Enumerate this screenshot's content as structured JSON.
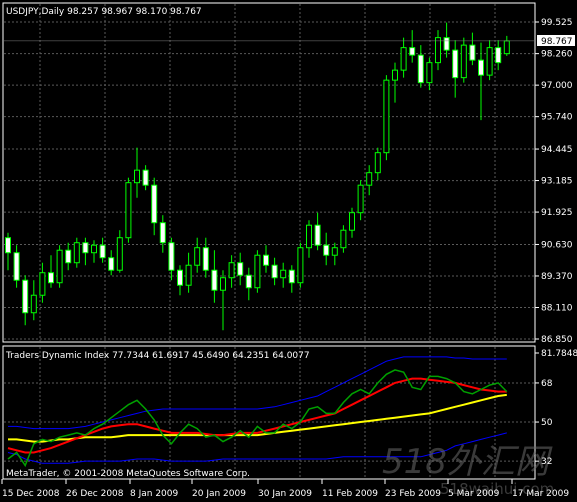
{
  "price_panel": {
    "title": "USDJPY,Daily  98.257 98.967 98.170 98.767",
    "current_price_tag": "98.767",
    "y_labels": [
      "99.525",
      "98.260",
      "97.000",
      "95.740",
      "94.445",
      "93.185",
      "91.925",
      "90.630",
      "89.370",
      "88.110",
      "86.850"
    ]
  },
  "indicator_panel": {
    "title": "Traders Dynamic Index 77.7344 61.6917 45.6490 64.2351 64.0077",
    "y_labels": [
      "81.7848",
      "68",
      "50",
      "32"
    ]
  },
  "copyright": "MetaTrader, © 2001-2008 MetaQuotes Software Corp.",
  "x_labels": [
    "15 Dec 2008",
    "26 Dec 2008",
    "8 Jan 2009",
    "20 Jan 2009",
    "30 Jan 2009",
    "11 Feb 2009",
    "23 Feb 2009",
    "5 Mar 2009",
    "17 Mar 2009"
  ],
  "watermark": {
    "main": "518外汇网",
    "sub": "518waihui.com"
  },
  "colors": {
    "background": "#000000",
    "grid": "#5a5a5a",
    "candle": "#00ff00",
    "bull_fill": "#000000",
    "bear_fill": "#ffffff",
    "tdi_green": "#00a000",
    "tdi_red": "#ff0000",
    "tdi_yellow": "#ffff00",
    "tdi_blue": "#0000ff"
  },
  "chart_data": [
    {
      "type": "candlestick",
      "title": "USDJPY,Daily",
      "ylim": [
        86.85,
        99.525
      ],
      "candles": [
        [
          90.9,
          91.1,
          89.6,
          90.3
        ],
        [
          90.3,
          90.6,
          88.9,
          89.2
        ],
        [
          89.2,
          89.4,
          87.4,
          87.9
        ],
        [
          87.9,
          89.2,
          87.6,
          88.6
        ],
        [
          88.6,
          89.9,
          88.3,
          89.5
        ],
        [
          89.5,
          90.2,
          88.9,
          89.1
        ],
        [
          89.1,
          90.6,
          88.9,
          90.4
        ],
        [
          90.4,
          90.7,
          89.6,
          89.9
        ],
        [
          89.9,
          90.9,
          89.7,
          90.7
        ],
        [
          90.7,
          90.9,
          89.8,
          90.3
        ],
        [
          90.3,
          90.8,
          89.9,
          90.6
        ],
        [
          90.6,
          90.9,
          89.9,
          90.1
        ],
        [
          90.1,
          90.4,
          89.4,
          89.6
        ],
        [
          89.6,
          91.2,
          89.5,
          90.9
        ],
        [
          90.9,
          93.3,
          90.7,
          93.1
        ],
        [
          93.1,
          94.5,
          92.5,
          93.6
        ],
        [
          93.6,
          93.8,
          92.8,
          93.0
        ],
        [
          93.0,
          93.3,
          91.0,
          91.5
        ],
        [
          91.5,
          91.8,
          90.3,
          90.7
        ],
        [
          90.7,
          90.9,
          89.2,
          89.6
        ],
        [
          89.6,
          89.8,
          88.6,
          89.0
        ],
        [
          89.0,
          90.3,
          88.7,
          89.8
        ],
        [
          89.8,
          90.9,
          89.5,
          90.5
        ],
        [
          90.5,
          90.9,
          89.3,
          89.6
        ],
        [
          89.6,
          90.4,
          88.3,
          88.8
        ],
        [
          88.8,
          89.6,
          87.2,
          89.3
        ],
        [
          89.3,
          90.2,
          88.9,
          89.9
        ],
        [
          89.9,
          90.3,
          89.0,
          89.4
        ],
        [
          89.4,
          89.7,
          88.4,
          88.9
        ],
        [
          88.9,
          90.4,
          88.7,
          90.2
        ],
        [
          90.2,
          90.6,
          89.5,
          89.8
        ],
        [
          89.8,
          90.1,
          89.0,
          89.3
        ],
        [
          89.3,
          89.9,
          88.9,
          89.6
        ],
        [
          89.6,
          89.8,
          88.7,
          89.1
        ],
        [
          89.1,
          90.7,
          88.9,
          90.5
        ],
        [
          90.5,
          91.6,
          90.1,
          91.4
        ],
        [
          91.4,
          91.9,
          90.4,
          90.6
        ],
        [
          90.6,
          91.1,
          89.8,
          90.2
        ],
        [
          90.2,
          90.7,
          89.8,
          90.5
        ],
        [
          90.5,
          91.4,
          90.3,
          91.2
        ],
        [
          91.2,
          92.1,
          90.9,
          91.9
        ],
        [
          91.9,
          93.2,
          91.6,
          93.0
        ],
        [
          93.0,
          93.8,
          92.6,
          93.5
        ],
        [
          93.5,
          94.5,
          93.2,
          94.3
        ],
        [
          94.3,
          97.4,
          94.0,
          97.2
        ],
        [
          97.2,
          97.9,
          96.3,
          97.6
        ],
        [
          97.6,
          98.9,
          97.3,
          98.5
        ],
        [
          98.5,
          99.2,
          97.9,
          98.2
        ],
        [
          98.2,
          98.6,
          96.9,
          97.1
        ],
        [
          97.1,
          98.1,
          96.8,
          97.9
        ],
        [
          97.9,
          99.2,
          97.6,
          98.9
        ],
        [
          98.9,
          99.5,
          98.1,
          98.4
        ],
        [
          98.4,
          98.8,
          96.5,
          97.3
        ],
        [
          97.3,
          98.9,
          97.1,
          98.6
        ],
        [
          98.6,
          99.1,
          97.8,
          98.0
        ],
        [
          98.0,
          98.7,
          95.6,
          97.4
        ],
        [
          97.4,
          98.8,
          97.2,
          98.5
        ],
        [
          98.5,
          98.8,
          97.6,
          97.9
        ],
        [
          98.26,
          98.97,
          98.17,
          98.77
        ]
      ]
    },
    {
      "type": "line",
      "title": "Traders Dynamic Index",
      "ylim": [
        27,
        81.7848
      ],
      "series": [
        {
          "color_key": "tdi_blue",
          "values": [
            48,
            48,
            47.5,
            47,
            47,
            47,
            47,
            47,
            47.5,
            48,
            49,
            50,
            51,
            52,
            53,
            54,
            55,
            55.5,
            56,
            56,
            56,
            56,
            56,
            56,
            56,
            56,
            56,
            56,
            56,
            56,
            56.5,
            57,
            58,
            59,
            60,
            61,
            62,
            64,
            66,
            68,
            70,
            72,
            74,
            76,
            78,
            79,
            80,
            80,
            80,
            80,
            80,
            80,
            79.5,
            79.5,
            79,
            79,
            79,
            79,
            79
          ]
        },
        {
          "color_key": "tdi_blue",
          "values": [
            36,
            35,
            33,
            32,
            31,
            31,
            31,
            31,
            31.5,
            32,
            32,
            32,
            32,
            32,
            32.5,
            33,
            33,
            33,
            32.5,
            32,
            32,
            32,
            32,
            32,
            32.5,
            33,
            33,
            33,
            33,
            33,
            33,
            33,
            33,
            33,
            33,
            33,
            33,
            33,
            33.5,
            34,
            34,
            34,
            34,
            34,
            34,
            34,
            34,
            34,
            34,
            35,
            36,
            37,
            39,
            40,
            41,
            42,
            43,
            44,
            45
          ]
        },
        {
          "color_key": "tdi_yellow",
          "values": [
            42,
            42,
            41.5,
            41,
            41,
            41.5,
            42,
            42,
            42.5,
            43,
            43,
            43,
            43,
            43.5,
            44,
            44,
            44,
            44,
            44,
            44,
            44,
            44,
            44,
            44,
            44,
            44,
            44,
            44,
            44,
            44,
            44.5,
            45,
            45.5,
            46,
            46.5,
            47,
            47.5,
            48,
            48.5,
            49,
            49.5,
            50,
            50.5,
            51,
            51.5,
            52,
            52.5,
            53,
            53.5,
            54,
            55,
            56,
            57,
            58,
            59,
            60,
            61,
            62,
            62.5
          ]
        },
        {
          "color_key": "tdi_red",
          "values": [
            38,
            37,
            36,
            36,
            37,
            38,
            39.5,
            41,
            42.5,
            44,
            45.5,
            47,
            48,
            48.5,
            49,
            49,
            48,
            47,
            46,
            45,
            45,
            45,
            45,
            44.5,
            44,
            44,
            44.5,
            45,
            45,
            45,
            46,
            47,
            48,
            49,
            50,
            51,
            52,
            53,
            54,
            56,
            58,
            60,
            62,
            64,
            66,
            68,
            69,
            70,
            70,
            69.5,
            69,
            68.5,
            68,
            67,
            66,
            65,
            64.5,
            64,
            64
          ]
        },
        {
          "color_key": "tdi_green",
          "values": [
            33,
            36,
            30,
            40,
            42,
            41,
            43,
            44,
            45,
            44,
            47,
            49,
            52,
            55,
            58,
            60,
            56,
            51,
            44,
            40,
            45,
            49,
            47,
            43,
            44,
            41,
            43,
            46,
            43,
            48,
            45,
            45,
            49,
            47,
            50,
            56,
            57,
            54,
            54,
            59,
            63,
            65,
            63,
            68,
            72,
            74,
            73,
            66,
            65,
            71,
            71,
            70,
            68,
            64,
            63,
            65,
            67,
            68,
            64
          ]
        }
      ]
    }
  ]
}
